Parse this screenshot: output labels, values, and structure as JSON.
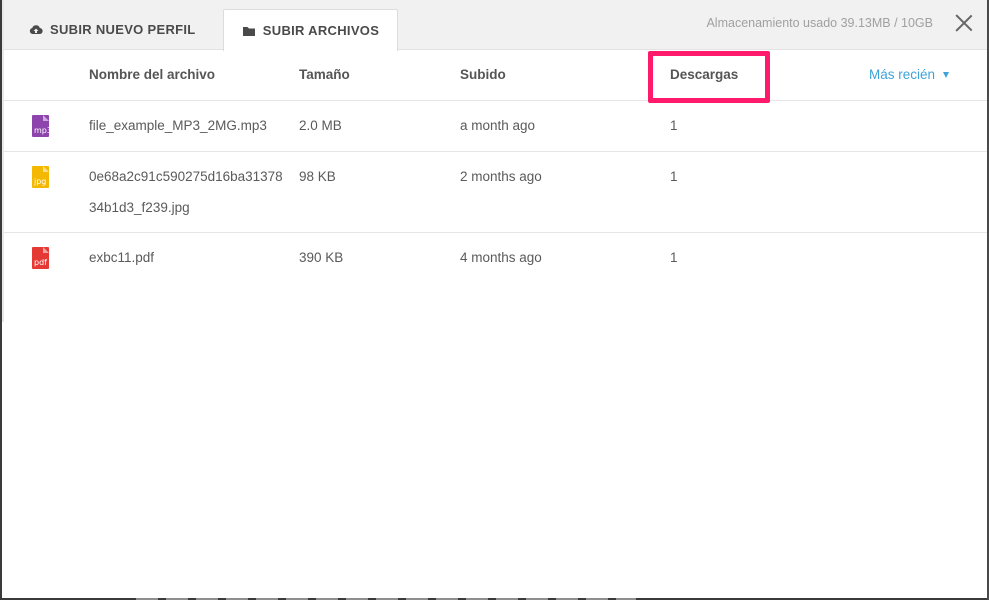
{
  "tabs": [
    {
      "label": "SUBIR NUEVO PERFIL",
      "icon": "cloud-upload-icon",
      "active": false
    },
    {
      "label": "SUBIR ARCHIVOS",
      "icon": "folder-icon",
      "active": true
    }
  ],
  "storage": "Almacenamiento usado 39.13MB / 10GB",
  "columns": {
    "name": "Nombre del archivo",
    "size": "Tamaño",
    "uploaded": "Subido",
    "downloads": "Descargas"
  },
  "sort": {
    "label": "Más recién"
  },
  "files": [
    {
      "name": "file_example_MP3_2MG.mp3",
      "size": "2.0 MB",
      "uploaded": "a month ago",
      "downloads": "1",
      "type": "mp3",
      "color": "#8e44ad"
    },
    {
      "name": "0e68a2c91c590275d16ba3137834b1d3_f239.jpg",
      "size": "98 KB",
      "uploaded": "2 months ago",
      "downloads": "1",
      "type": "jpg",
      "color": "#f5b800"
    },
    {
      "name": "exbc11.pdf",
      "size": "390 KB",
      "uploaded": "4 months ago",
      "downloads": "1",
      "type": "pdf",
      "color": "#e53935"
    }
  ],
  "colors": {
    "highlight": "#ff1a6b",
    "link": "#3fa3d8"
  }
}
